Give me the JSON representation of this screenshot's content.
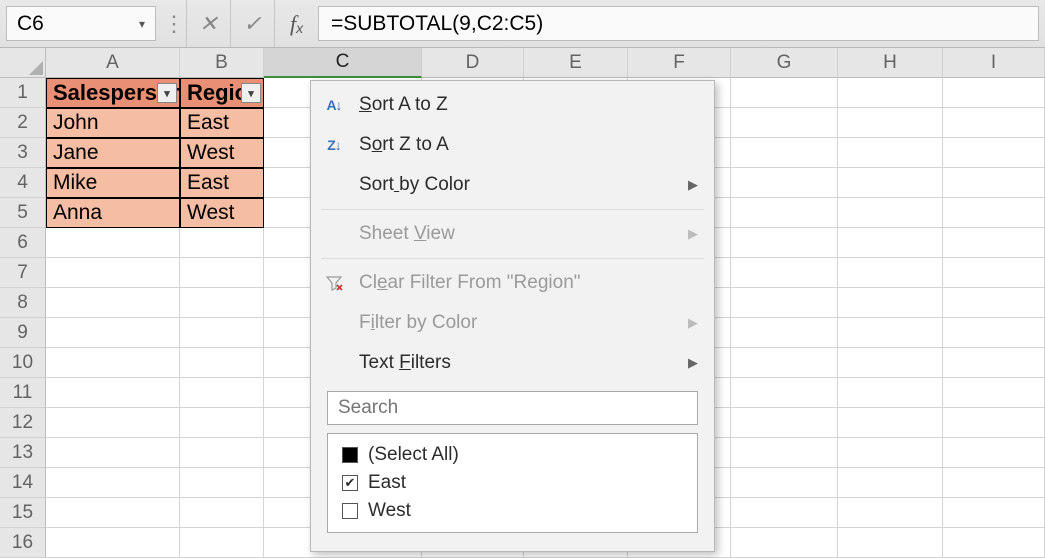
{
  "namebox": "C6",
  "formula": "=SUBTOTAL(9,C2:C5)",
  "columns": [
    "A",
    "B",
    "C",
    "D",
    "E",
    "F",
    "G",
    "H",
    "I"
  ],
  "activeCol": "C",
  "rowcount": 16,
  "headers": {
    "A": "Salesperson",
    "B": "Region"
  },
  "rows": [
    {
      "A": "John",
      "B": "East"
    },
    {
      "A": "Jane",
      "B": "West"
    },
    {
      "A": "Mike",
      "B": "East"
    },
    {
      "A": "Anna",
      "B": "West"
    }
  ],
  "menu": {
    "sortAZ": "Sort A to Z",
    "sortZA": "Sort Z to A",
    "sortColor": "Sort by Color",
    "sheetView": "Sheet View",
    "clearFilter": "Clear Filter From \"Region\"",
    "filterColor": "Filter by Color",
    "textFilters": "Text Filters",
    "searchPlaceholder": "Search",
    "opts": {
      "selectAll": "(Select All)",
      "east": "East",
      "west": "West"
    },
    "state": {
      "selectAll": "indeterminate",
      "east": true,
      "west": false
    }
  }
}
